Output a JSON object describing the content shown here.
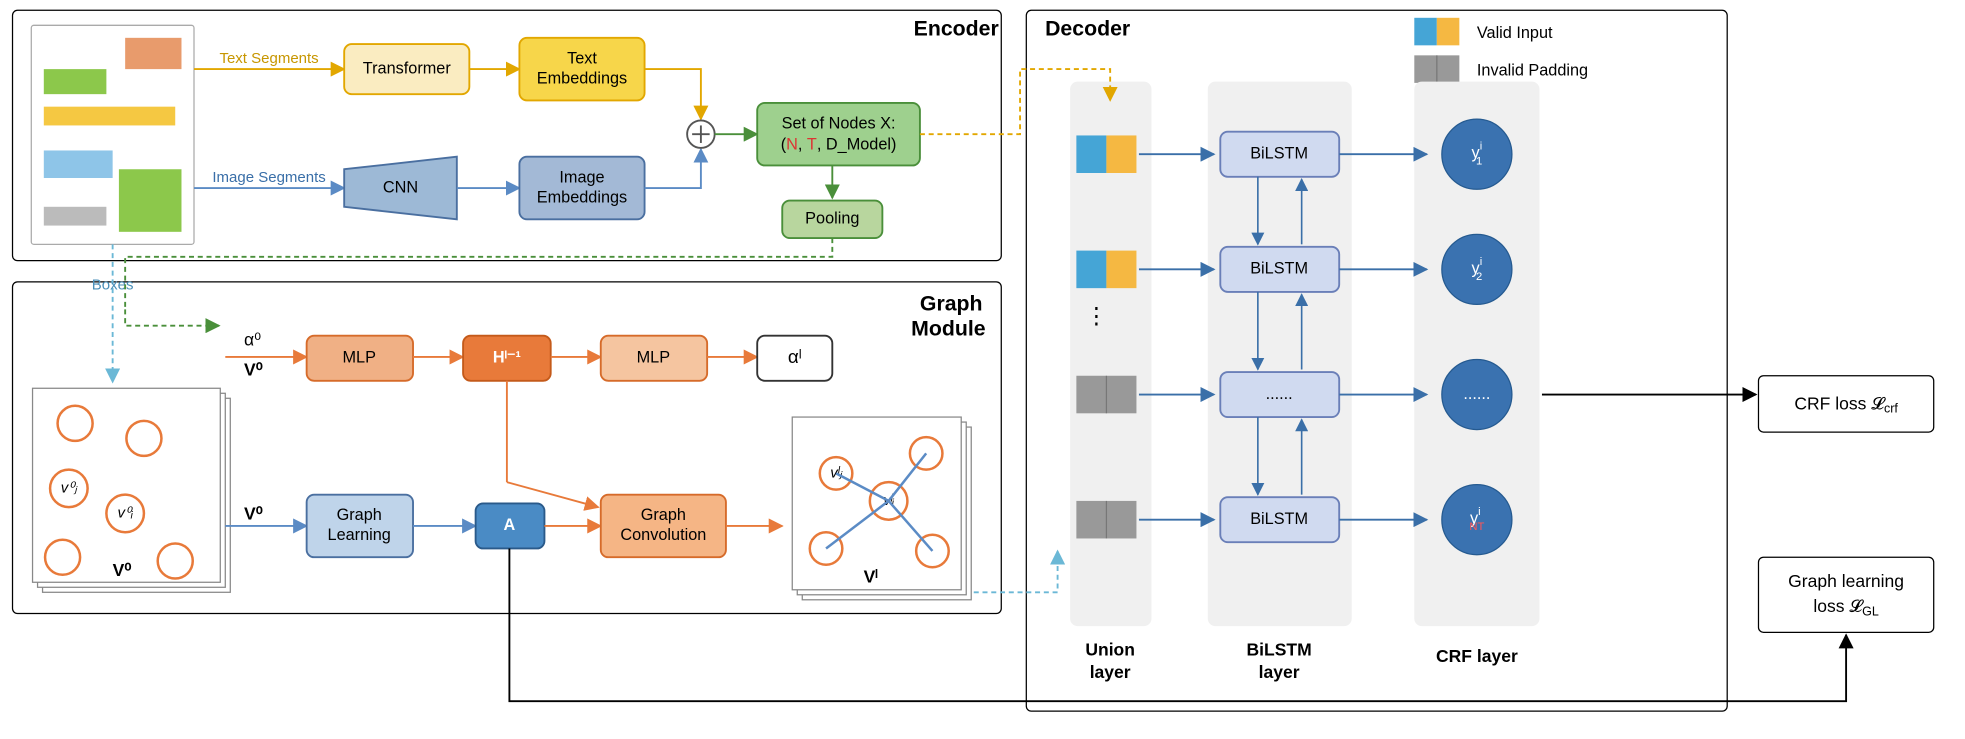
{
  "encoder": {
    "title": "Encoder",
    "textSegments": "Text Segments",
    "imageSegments": "Image Segments",
    "transformer": "Transformer",
    "textEmb": "Text\nEmbeddings",
    "cnn": "CNN",
    "imageEmb": "Image\nEmbeddings",
    "setNodes1": "Set of Nodes X:",
    "setNodesN": "N",
    "setNodesComma1": ", ",
    "setNodesT": "T",
    "setNodesRest": ", D_Model)",
    "pooling": "Pooling"
  },
  "graph": {
    "title": "Graph\nModule",
    "boxes": "Boxes",
    "alpha0": "α⁰",
    "V0": "V⁰",
    "V0b": "V⁰",
    "V0lab": "V⁰",
    "mlp1": "MLP",
    "H": "Hˡ⁻¹",
    "mlp2": "MLP",
    "alphaL": "αˡ",
    "graphLearn": "Graph\nLearning",
    "A": "A",
    "graphConv": "Graph\nConvolution",
    "Vl": "Vˡ",
    "vj0": "v⁰ⱼ",
    "vi0": "v⁰ᵢ",
    "vjl": "vˡⱼ",
    "vil": "vˡᵢ"
  },
  "decoder": {
    "title": "Decoder",
    "validInput": "Valid Input",
    "invalidPadding": "Invalid Padding",
    "bilstm": "BiLSTM",
    "dots": "......",
    "y1": "y",
    "y1sup": "i",
    "y1sub": "1",
    "y2sub": "2",
    "yNT": "NT",
    "union": "Union\nlayer",
    "bilstmLayer": "BiLSTM\nlayer",
    "crfLayer": "CRF layer",
    "ellipsis": "⋮"
  },
  "losses": {
    "crf": "CRF loss 𝓛",
    "crfSub": "crf",
    "gl": "Graph learning\nloss 𝓛",
    "glSub": "GL"
  }
}
